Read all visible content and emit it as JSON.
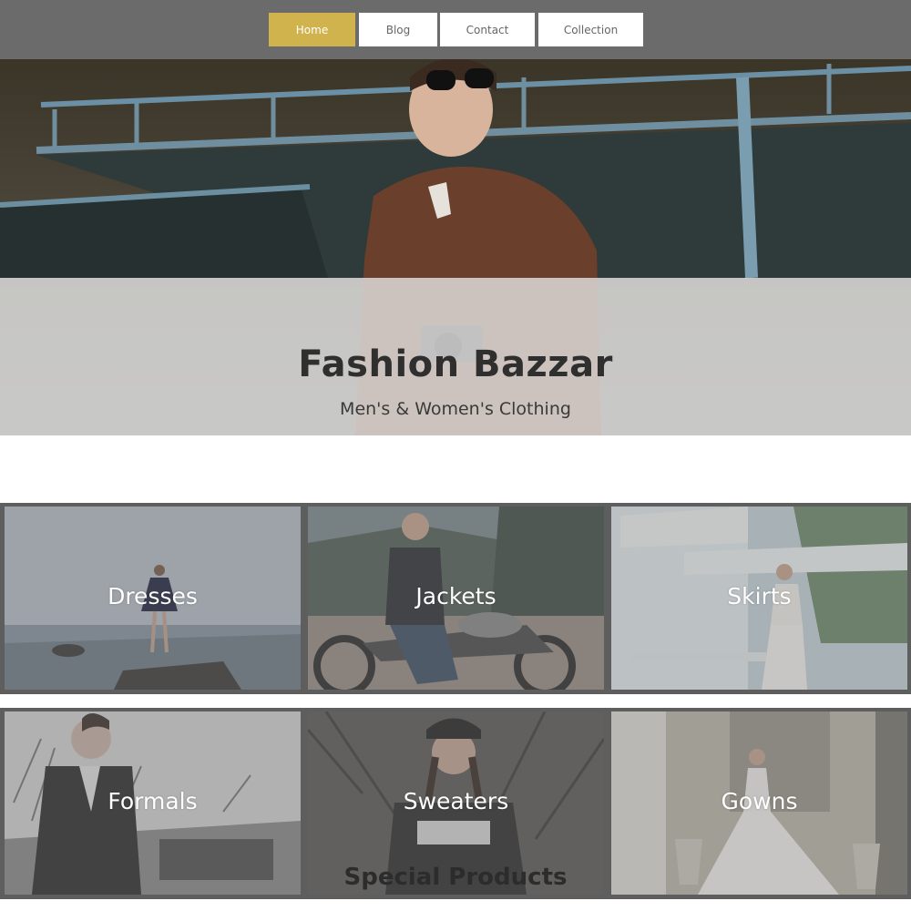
{
  "nav": {
    "items": [
      {
        "label": "Home",
        "active": true
      },
      {
        "label": "Blog",
        "active": false
      },
      {
        "label": "Contact",
        "active": false
      },
      {
        "label": "Collection",
        "active": false
      }
    ]
  },
  "hero": {
    "title": "Fashion Bazzar",
    "subtitle": "Men's & Women's Clothing"
  },
  "categories": [
    {
      "label": "Dresses"
    },
    {
      "label": "Jackets"
    },
    {
      "label": "Skirts"
    },
    {
      "label": "Formals"
    },
    {
      "label": "Sweaters"
    },
    {
      "label": "Gowns"
    }
  ],
  "special": {
    "title": "Special Products"
  },
  "colors": {
    "nav_bg": "#6b6b6b",
    "accent": "#d1b34d",
    "grid_border": "#5e5e5e"
  }
}
